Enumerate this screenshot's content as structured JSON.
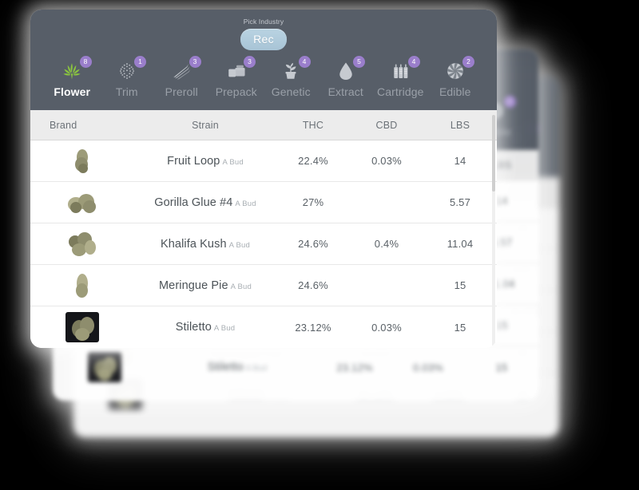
{
  "header": {
    "pick_industry_label": "Pick Industry",
    "industry_selected": "Rec",
    "background_color": "#575E68",
    "pill_color": "#AFCBDC"
  },
  "categories": [
    {
      "label": "Flower",
      "count": "8",
      "icon": "cannabis-leaf-icon",
      "active": true
    },
    {
      "label": "Trim",
      "count": "1",
      "icon": "trim-dots-icon",
      "active": false
    },
    {
      "label": "Preroll",
      "count": "3",
      "icon": "preroll-cone-icon",
      "active": false
    },
    {
      "label": "Prepack",
      "count": "3",
      "icon": "prepack-jar-icon",
      "active": false
    },
    {
      "label": "Genetic",
      "count": "4",
      "icon": "seedling-pot-icon",
      "active": false
    },
    {
      "label": "Extract",
      "count": "5",
      "icon": "oil-drop-icon",
      "active": false
    },
    {
      "label": "Cartridge",
      "count": "4",
      "icon": "vape-cartridge-icon",
      "active": false
    },
    {
      "label": "Edible",
      "count": "2",
      "icon": "candy-swirl-icon",
      "active": false
    }
  ],
  "badge_color": "#9A7ECB",
  "table": {
    "columns": [
      "Brand",
      "Strain",
      "THC",
      "CBD",
      "LBS"
    ],
    "rows": [
      {
        "thumb": "bud-thumbnail",
        "strain": "Fruit Loop",
        "sub": "A Bud",
        "thc": "22.4%",
        "cbd": "0.03%",
        "lbs": "14"
      },
      {
        "thumb": "bud-thumbnail",
        "strain": "Gorilla Glue #4",
        "sub": "A Bud",
        "thc": "27%",
        "cbd": "",
        "lbs": "5.57"
      },
      {
        "thumb": "bud-thumbnail",
        "strain": "Khalifa Kush",
        "sub": "A Bud",
        "thc": "24.6%",
        "cbd": "0.4%",
        "lbs": "11.04"
      },
      {
        "thumb": "bud-thumbnail",
        "strain": "Meringue Pie",
        "sub": "A Bud",
        "thc": "24.6%",
        "cbd": "",
        "lbs": "15"
      },
      {
        "thumb": "bud-thumbnail",
        "strain": "Stiletto",
        "sub": "A Bud",
        "thc": "23.12%",
        "cbd": "0.03%",
        "lbs": "15"
      }
    ]
  }
}
